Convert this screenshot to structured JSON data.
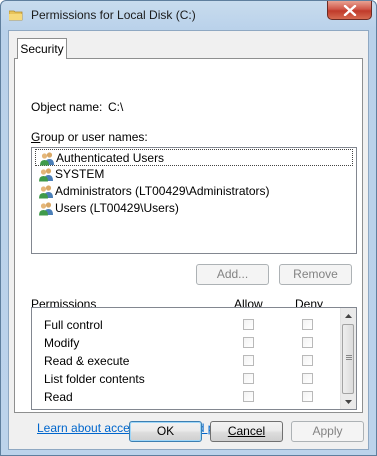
{
  "window": {
    "title": "Permissions for Local Disk (C:)"
  },
  "tabs": [
    {
      "label": "Security"
    }
  ],
  "object_name": {
    "label": "Object name:",
    "value": "C:\\"
  },
  "groups": {
    "label_prefix": "G",
    "label_rest": "roup or user names:",
    "items": [
      {
        "name": "Authenticated Users",
        "selected": true,
        "icon": "users-group-icon"
      },
      {
        "name": "SYSTEM",
        "selected": false,
        "icon": "users-group-icon"
      },
      {
        "name": "Administrators (LT00429\\Administrators)",
        "selected": false,
        "icon": "users-group-icon"
      },
      {
        "name": "Users (LT00429\\Users)",
        "selected": false,
        "icon": "users-group-icon"
      }
    ]
  },
  "buttons": {
    "add": "Add...",
    "remove": "Remove",
    "ok": "OK",
    "cancel": "Cancel",
    "apply": "Apply"
  },
  "permissions": {
    "header_label": "Permissions",
    "allow_label": "Allow",
    "deny_label": "Deny",
    "items": [
      {
        "name": "Full control",
        "allow": false,
        "deny": false
      },
      {
        "name": "Modify",
        "allow": false,
        "deny": false
      },
      {
        "name": "Read & execute",
        "allow": false,
        "deny": false
      },
      {
        "name": "List folder contents",
        "allow": false,
        "deny": false
      },
      {
        "name": "Read",
        "allow": false,
        "deny": false
      }
    ]
  },
  "link": {
    "text": "Learn about access control and permissions"
  },
  "colors": {
    "link": "#0066cc",
    "close_button": "#c03a2a",
    "window_frame": "#b9d1ea"
  }
}
